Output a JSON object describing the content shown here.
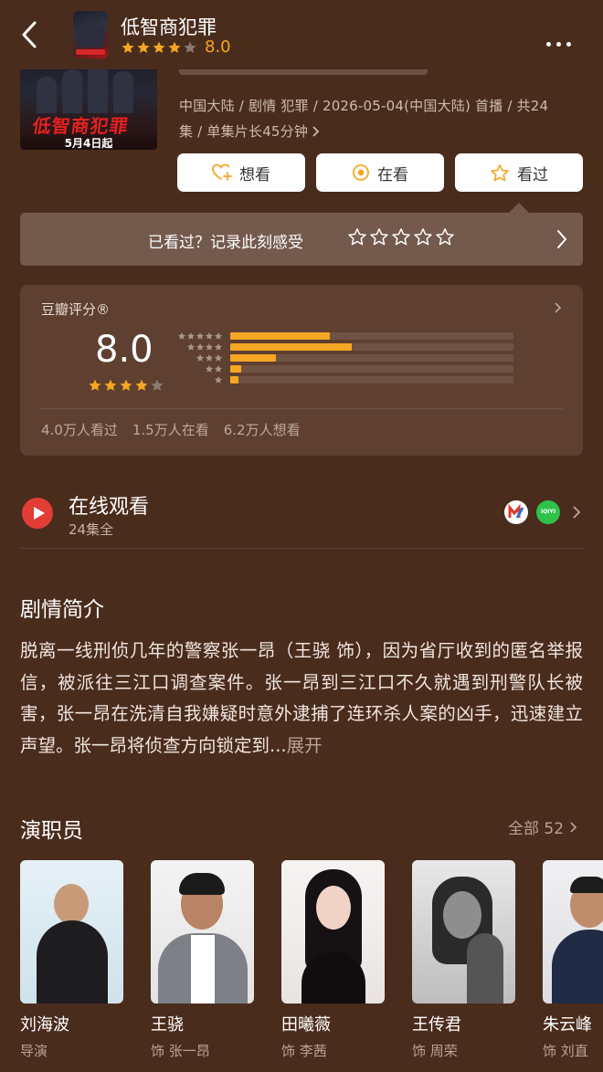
{
  "header": {
    "title": "低智商犯罪",
    "rating_value": 8.0,
    "rating_text": "8.0",
    "stars_filled": 4
  },
  "poster": {
    "title": "低智商犯罪",
    "date": "5月4日起"
  },
  "meta": {
    "line1": "中国大陆 / 剧情 犯罪 / 2026-05-04(中国大陆) 首播 / 共24",
    "line2": "集 / 单集片长45分钟"
  },
  "actions": [
    {
      "label": "想看",
      "icon": "heart-plus-icon"
    },
    {
      "label": "在看",
      "icon": "target-icon"
    },
    {
      "label": "看过",
      "icon": "star-outline-icon"
    }
  ],
  "seen_prompt": {
    "text": "已看过？记录此刻感受",
    "stars": 5
  },
  "rating": {
    "label": "豆瓣评分®",
    "score": "8.0",
    "stars_filled": 4,
    "distribution": [
      {
        "stars": 5,
        "fraction": 0.35
      },
      {
        "stars": 4,
        "fraction": 0.43
      },
      {
        "stars": 3,
        "fraction": 0.16
      },
      {
        "stars": 2,
        "fraction": 0.04
      },
      {
        "stars": 1,
        "fraction": 0.03
      }
    ],
    "counts": [
      "4.0万人看过",
      "1.5万人在看",
      "6.2万人想看"
    ]
  },
  "online": {
    "title": "在线观看",
    "subtitle": "24集全",
    "platforms": [
      "mango-tv-icon",
      "iqiyi-icon"
    ],
    "iqiyi_text": "iQIYI"
  },
  "synopsis": {
    "title": "剧情简介",
    "text": "脱离一线刑侦几年的警察张一昂（王骁 饰），因为省厅收到的匿名举报信，被派往三江口调查案件。张一昂到三江口不久就遇到刑警队长被害，张一昂在洗清自我嫌疑时意外逮捕了连环杀人案的凶手，迅速建立声望。张一昂将侦查方向锁定到...",
    "expand": "展开"
  },
  "cast": {
    "title": "演职员",
    "all_label": "全部 52",
    "members": [
      {
        "name": "刘海波",
        "role": "导演"
      },
      {
        "name": "王骁",
        "role": "饰 张一昂"
      },
      {
        "name": "田曦薇",
        "role": "饰 李茜"
      },
      {
        "name": "王传君",
        "role": "饰 周荣"
      },
      {
        "name": "朱云峰",
        "role": "饰 刘直"
      }
    ]
  },
  "colors": {
    "background": "#4a2c1d",
    "accent": "#f5a623",
    "play": "#e23d35"
  }
}
